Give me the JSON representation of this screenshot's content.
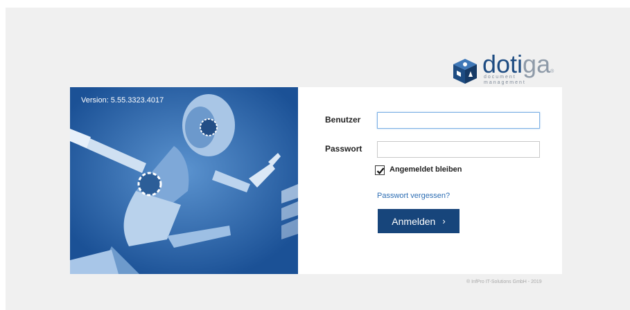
{
  "brand": {
    "word_main": "doti",
    "word_accent": "ga",
    "registered": "®",
    "tagline_line1": "document",
    "tagline_line2": "management",
    "icon": "dotiga-cube-icon"
  },
  "hero": {
    "version_text": "Version: 5.55.3323.4017",
    "image": "running-robot-illustration"
  },
  "login": {
    "user_label": "Benutzer",
    "user_value": "",
    "password_label": "Passwort",
    "password_value": "",
    "remember_label": "Angemeldet bleiben",
    "remember_checked": true,
    "forgot_link": "Passwort vergessen?",
    "submit_label": "Anmelden",
    "submit_icon": "chevron-right-icon"
  },
  "footer": {
    "copyright": "® InfPro IT-Solutions GmbH - 2019"
  },
  "colors": {
    "brand_blue": "#17457b",
    "hero_blue": "#1b5196",
    "link_blue": "#2c6db3",
    "page_bg": "#f0f0f0"
  }
}
